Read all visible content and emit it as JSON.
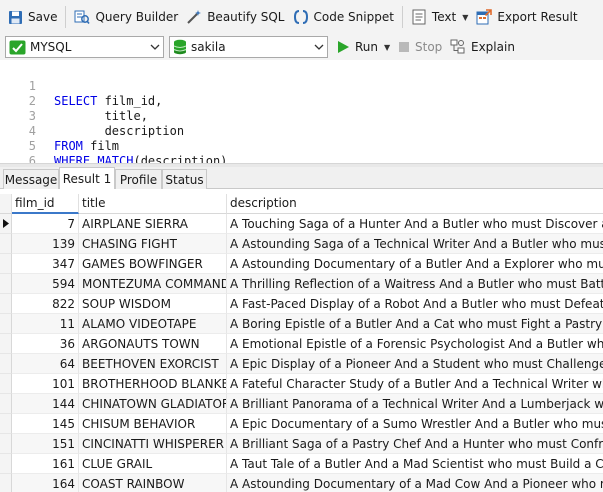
{
  "toolbar": {
    "save": "Save",
    "query_builder": "Query Builder",
    "beautify": "Beautify SQL",
    "code_snippet": "Code Snippet",
    "text": "Text",
    "export": "Export Result"
  },
  "bar2": {
    "connection": "MYSQL",
    "database": "sakila",
    "run": "Run",
    "stop": "Stop",
    "explain": "Explain"
  },
  "editor": {
    "line_numbers": [
      "1",
      "2",
      "3",
      "4",
      "5",
      "6"
    ]
  },
  "tabs": {
    "message": "Message",
    "result1": "Result 1",
    "profile": "Profile",
    "status": "Status"
  },
  "grid": {
    "columns": {
      "film_id": "film_id",
      "title": "title",
      "description": "description"
    },
    "rows": [
      {
        "film_id": "7",
        "title": "AIRPLANE SIERRA",
        "description": "A Touching Saga of a Hunter And a Butler who must Discover a Butler"
      },
      {
        "film_id": "139",
        "title": "CHASING FIGHT",
        "description": "A Astounding Saga of a Technical Writer And a Butler who must Battle"
      },
      {
        "film_id": "347",
        "title": "GAMES BOWFINGER",
        "description": "A Astounding Documentary of a Butler And a Explorer who must Chall"
      },
      {
        "film_id": "594",
        "title": "MONTEZUMA COMMAND",
        "description": "A Thrilling Reflection of a Waitress And a Butler who must Battle a Butl"
      },
      {
        "film_id": "822",
        "title": "SOUP WISDOM",
        "description": "A Fast-Paced Display of a Robot And a Butler who must Defeat a Butler"
      },
      {
        "film_id": "11",
        "title": "ALAMO VIDEOTAPE",
        "description": "A Boring Epistle of a Butler And a Cat who must Fight a Pastry Chef in"
      },
      {
        "film_id": "36",
        "title": "ARGONAUTS TOWN",
        "description": "A Emotional Epistle of a Forensic Psychologist And a Butler who must"
      },
      {
        "film_id": "64",
        "title": "BEETHOVEN EXORCIST",
        "description": "A Epic Display of a Pioneer And a Student who must Challenge a Butle"
      },
      {
        "film_id": "101",
        "title": "BROTHERHOOD BLANKET",
        "description": "A Fateful Character Study of a Butler And a Technical Writer who must"
      },
      {
        "film_id": "144",
        "title": "CHINATOWN GLADIATOR",
        "description": "A Brilliant Panorama of a Technical Writer And a Lumberjack who mus"
      },
      {
        "film_id": "145",
        "title": "CHISUM BEHAVIOR",
        "description": "A Epic Documentary of a Sumo Wrestler And a Butler who must Kill a C"
      },
      {
        "film_id": "151",
        "title": "CINCINATTI WHISPERER",
        "description": "A Brilliant Saga of a Pastry Chef And a Hunter who must Confront a Bu"
      },
      {
        "film_id": "161",
        "title": "CLUE GRAIL",
        "description": "A Taut Tale of a Butler And a Mad Scientist who must Build a Crocodil"
      },
      {
        "film_id": "164",
        "title": "COAST RAINBOW",
        "description": "A Astounding Documentary of a Mad Cow And a Pioneer who must Chal"
      }
    ]
  },
  "colors": {
    "keyword": "#0000e6",
    "string": "#c00000",
    "run": "#2aa52a",
    "selected_header": "#3b78c9"
  }
}
